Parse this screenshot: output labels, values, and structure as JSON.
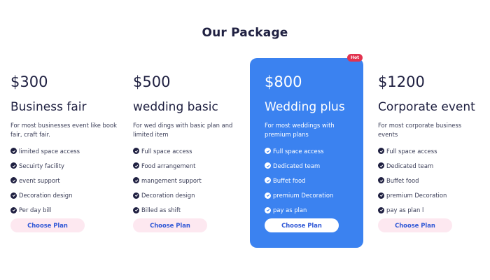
{
  "heading": "Our Package",
  "colors": {
    "accent": "#3b82f0",
    "dark_text": "#1f2041",
    "button_bg": "#fde8f0",
    "button_text": "#3058d6",
    "badge": "#e2334f"
  },
  "plans": [
    {
      "price": "$300",
      "name": "Business fair",
      "description": "For most businesses event like book fair, craft fair.",
      "features": [
        "limited space access",
        "Secuirty facility",
        "event support",
        "Decoration design",
        "Per day bill"
      ],
      "button": "Choose Plan"
    },
    {
      "price": "$500",
      "name": "wedding basic",
      "description": "For wed dings with basic plan and limited item",
      "features": [
        "Full space access",
        "Food arrangement",
        "mangement support",
        "Decoration design",
        "Billed as shift"
      ],
      "button": "Choose Plan"
    },
    {
      "price": "$800",
      "name": "Wedding plus",
      "description": "For most weddings with premium plans",
      "features": [
        "Full space access",
        "Dedicated team",
        "Buffet food",
        "premium Decoration",
        "pay as plan"
      ],
      "button": "Choose Plan",
      "badge": "Hot"
    },
    {
      "price": "$1200",
      "name": "Corporate event",
      "description": "For most corporate business events",
      "features": [
        "Full space access",
        "Dedicated team",
        "Buffet food",
        "premium Decoration",
        "pay as plan l"
      ],
      "button": "Choose Plan"
    }
  ],
  "icons": {
    "feature": "check-circle-icon"
  }
}
